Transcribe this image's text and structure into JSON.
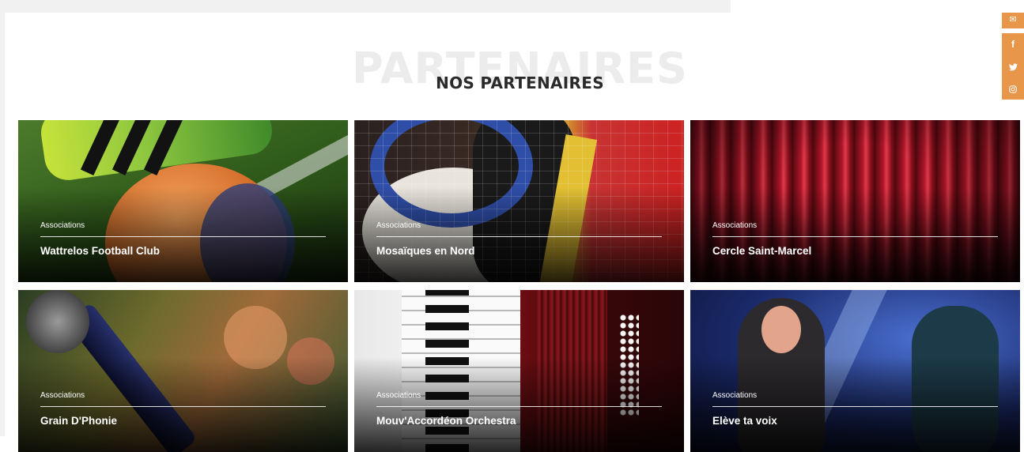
{
  "header": {
    "watermark": "PARTENAIRES",
    "title": "NOS PARTENAIRES"
  },
  "social": {
    "items": [
      {
        "icon": "mail-icon",
        "glyph": "✉"
      },
      {
        "icon": "facebook-icon",
        "glyph": "f"
      },
      {
        "icon": "twitter-icon",
        "glyph": "🐦"
      },
      {
        "icon": "instagram-icon",
        "glyph": "◎"
      }
    ],
    "accent": "#e8964a"
  },
  "partners": [
    {
      "category": "Associations",
      "name": "Wattrelos Football Club"
    },
    {
      "category": "Associations",
      "name": "Mosaïques en Nord"
    },
    {
      "category": "Associations",
      "name": "Cercle Saint-Marcel"
    },
    {
      "category": "Associations",
      "name": "Grain D'Phonie"
    },
    {
      "category": "Associations",
      "name": "Mouv'Accordéon Orchestra"
    },
    {
      "category": "Associations",
      "name": "Elève ta voix"
    }
  ]
}
